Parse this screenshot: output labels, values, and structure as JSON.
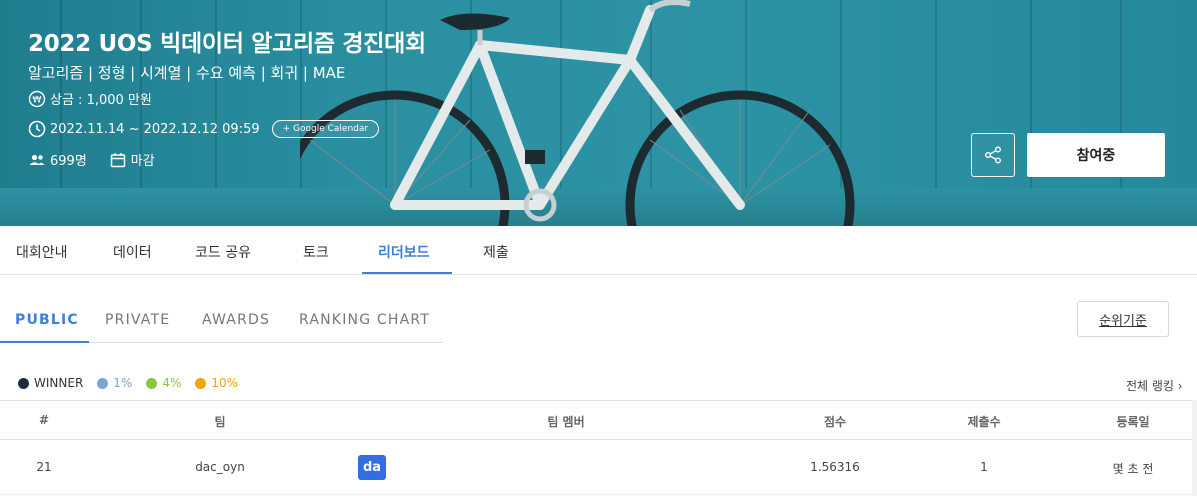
{
  "hero": {
    "title": "2022 UOS 빅데이터 알고리즘 경진대회",
    "tags": "알고리즘 | 정형 | 시계열 | 수요 예측 | 회귀 | MAE",
    "prize": "상금 : 1,000 만원",
    "period": "2022.11.14 ~ 2022.12.12 09:59",
    "calendar_button": "+ Google Calendar",
    "participants": "699명",
    "status": "마감",
    "join_button": "참여중"
  },
  "main_tabs": [
    "대회안내",
    "데이터",
    "코드 공유",
    "토크",
    "리더보드",
    "제출"
  ],
  "sub_tabs": [
    "PUBLIC",
    "PRIVATE",
    "AWARDS",
    "RANKING CHART"
  ],
  "criteria_button": "순위기준",
  "legend": [
    {
      "label": "WINNER",
      "color": "#1f2a3a"
    },
    {
      "label": "1%",
      "color": "#7aa6d6"
    },
    {
      "label": "4%",
      "color": "#8cc63f"
    },
    {
      "label": "10%",
      "color": "#f0a30a"
    }
  ],
  "full_ranking_link": "전체 랭킹 ›",
  "table": {
    "headers": [
      "#",
      "팀",
      "팀 멤버",
      "점수",
      "제출수",
      "등록일"
    ],
    "rows": [
      {
        "rank": "21",
        "team": "dac_oyn",
        "member_initials": "da",
        "score": "1.56316",
        "submissions": "1",
        "registered": "몇 초 전"
      }
    ]
  }
}
